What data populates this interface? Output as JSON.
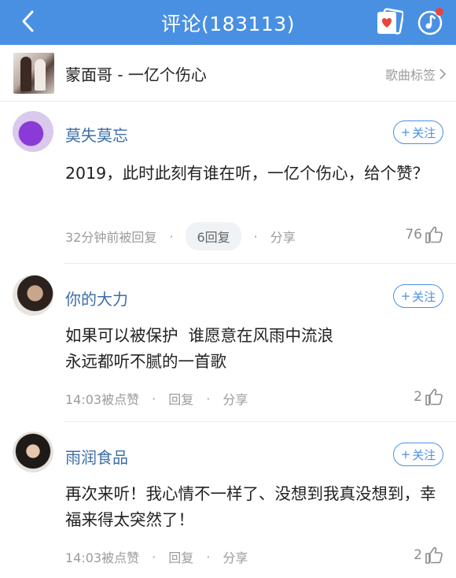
{
  "header": {
    "title": "评论(183113)",
    "back_icon": "chevron-left-icon",
    "share_icon": "heart-card-icon",
    "music_icon": "music-note-icon",
    "accent": "#4a90e2",
    "badge_color": "#e8443a"
  },
  "song": {
    "title": "蒙面哥 - 一亿个伤心",
    "tag_label": "歌曲标签"
  },
  "comments": [
    {
      "name": "莫失莫忘",
      "follow_label": "关注",
      "text": "2019，此时此刻有谁在听，一亿个伤心，给个赞？",
      "time": "32分钟前被回复",
      "replies_label": "6回复",
      "share_label": "分享",
      "likes": "76"
    },
    {
      "name": "你的大力",
      "follow_label": "关注",
      "text_line1": "如果可以被保护  谁愿意在风雨中流浪",
      "text_line2": "永远都听不腻的一首歌",
      "time": "14:03被点赞",
      "reply_label": "回复",
      "share_label": "分享",
      "likes": "2"
    },
    {
      "name": "雨润食品",
      "follow_label": "关注",
      "text": "再次来听！我心情不一样了、没想到我真没想到，幸福来得太突然了！",
      "time": "14:03被点赞",
      "reply_label": "回复",
      "share_label": "分享",
      "likes": "2"
    }
  ]
}
